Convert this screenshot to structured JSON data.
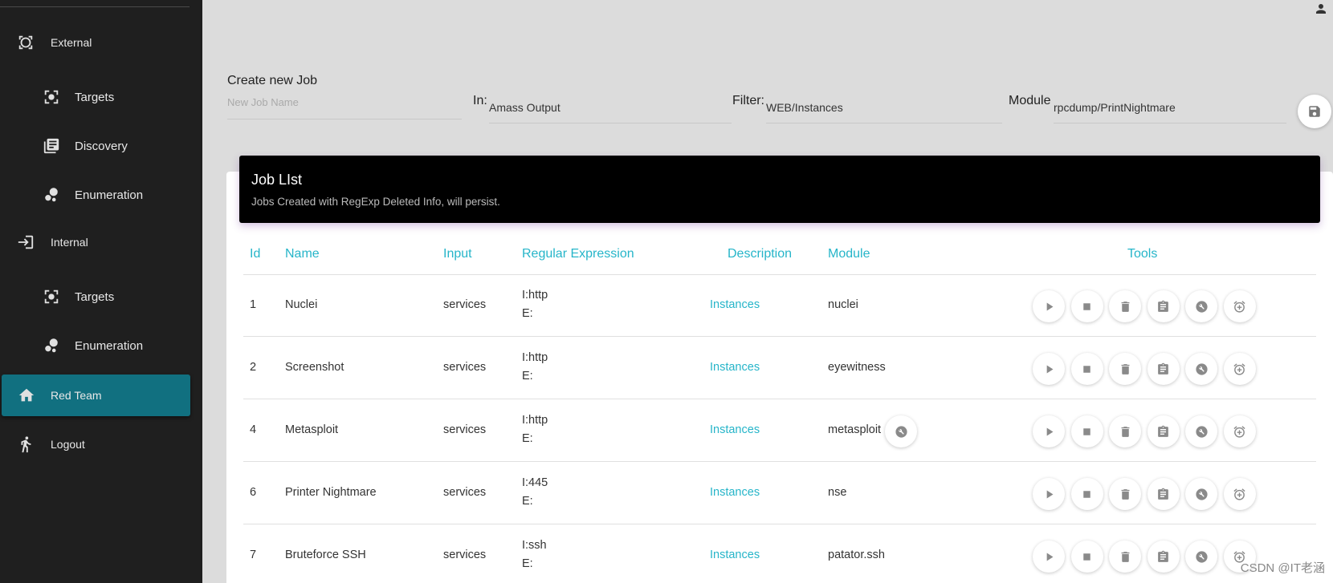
{
  "sidebar": {
    "items": [
      {
        "label": "External",
        "icon": "external-icon"
      },
      {
        "label": "Targets",
        "icon": "target-icon"
      },
      {
        "label": "Discovery",
        "icon": "library-icon"
      },
      {
        "label": "Enumeration",
        "icon": "bubble-icon"
      },
      {
        "label": "Internal",
        "icon": "login-icon"
      },
      {
        "label": "Targets",
        "icon": "target-icon"
      },
      {
        "label": "Enumeration",
        "icon": "bubble-icon"
      },
      {
        "label": "Red Team",
        "icon": "home-icon",
        "active": true
      },
      {
        "label": "Logout",
        "icon": "run-icon"
      }
    ]
  },
  "form": {
    "title": "Create new Job",
    "job_name_placeholder": "New Job Name",
    "in_label": "In:",
    "in_value": "Amass Output",
    "filter_label": "Filter:",
    "filter_value": "WEB/Instances",
    "module_label": "Module",
    "module_value": "rpcdump/PrintNightmare"
  },
  "job_list": {
    "title": "Job LIst",
    "subtitle": "Jobs Created with RegExp Deleted Info, will persist.",
    "columns": [
      "Id",
      "Name",
      "Input",
      "Regular Expression",
      "Description",
      "Module",
      "Tools"
    ],
    "rows": [
      {
        "id": "1",
        "name": "Nuclei",
        "input": "services",
        "regex_i": "I:http",
        "regex_e": "E:",
        "description": "Instances",
        "module": "nuclei",
        "module_tool": false
      },
      {
        "id": "2",
        "name": "Screenshot",
        "input": "services",
        "regex_i": "I:http",
        "regex_e": "E:",
        "description": "Instances",
        "module": "eyewitness",
        "module_tool": false
      },
      {
        "id": "4",
        "name": "Metasploit",
        "input": "services",
        "regex_i": "I:http",
        "regex_e": "E:",
        "description": "Instances",
        "module": "metasploit",
        "module_tool": true
      },
      {
        "id": "6",
        "name": "Printer Nightmare",
        "input": "services",
        "regex_i": "I:445",
        "regex_e": "E:",
        "description": "Instances",
        "module": "nse",
        "module_tool": false
      },
      {
        "id": "7",
        "name": "Bruteforce SSH",
        "input": "services",
        "regex_i": "I:ssh",
        "regex_e": "E:",
        "description": "Instances",
        "module": "patator.ssh",
        "module_tool": false
      }
    ],
    "tools": [
      "play-icon",
      "stop-icon",
      "delete-icon",
      "clipboard-icon",
      "build-icon",
      "alarm-add-icon"
    ]
  },
  "watermark": "CSDN @IT老涵",
  "colors": {
    "accent": "#26b5c9",
    "active_nav": "#117080",
    "sidebar_bg": "#1f1f1f"
  }
}
